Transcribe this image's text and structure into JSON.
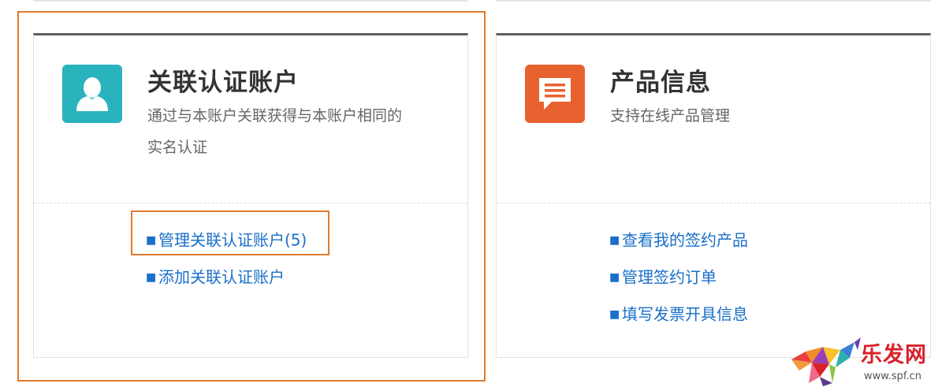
{
  "colors": {
    "accent_link": "#1a6fc9",
    "card_top_border": "#5f5f5f",
    "highlight": "#e07b2d",
    "account_icon_bg": "#29b3bd",
    "product_icon_bg": "#e8622f",
    "watermark_red": "#d8212a"
  },
  "left_card": {
    "icon": "user-icon",
    "title": "关联认证账户",
    "description": "通过与本账户关联获得与本账户相同的实名认证",
    "links": [
      {
        "label": "管理关联认证账户(5)"
      },
      {
        "label": "添加关联认证账户"
      }
    ]
  },
  "right_card": {
    "icon": "message-icon",
    "title": "产品信息",
    "description": "支持在线产品管理",
    "links": [
      {
        "label": "查看我的签约产品"
      },
      {
        "label": "管理签约订单"
      },
      {
        "label": "填写发票开具信息"
      }
    ]
  },
  "watermark": {
    "name": "乐发网",
    "url": "www.spf.cn",
    "logo_icon": "geometric-bull-icon"
  }
}
